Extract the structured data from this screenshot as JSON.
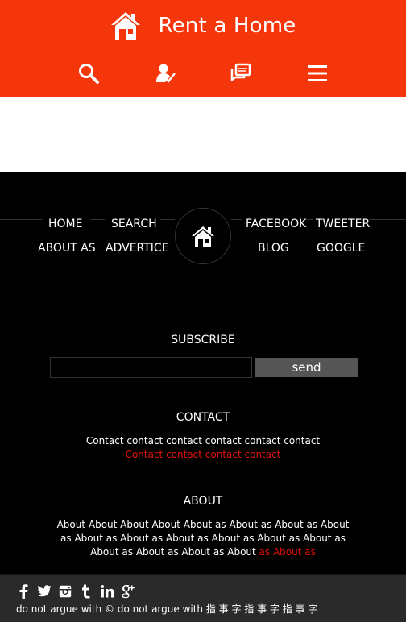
{
  "header": {
    "title": "Rent a Home",
    "nav_icons": [
      "search-icon",
      "user-check-icon",
      "chat-icon",
      "menu-icon"
    ]
  },
  "footer_nav": {
    "links_left": [
      "HOME",
      "SEARCH",
      "ABOUT AS",
      "ADVERTICE"
    ],
    "links_right": [
      "FACEBOOK",
      "TWEETER",
      "BLOG",
      "GOOGLE"
    ],
    "center_icon": "home-icon"
  },
  "subscribe": {
    "title": "SUBSCRIBE",
    "input_value": "",
    "input_placeholder": "",
    "button_label": "send"
  },
  "contact": {
    "title": "CONTACT",
    "line1": "Contact contact contact contact contact contact",
    "line2": "Contact contact contact contact"
  },
  "about": {
    "title": "ABOUT",
    "text": "About About About About About as About as About as About as About as About as About as About as About as About as About as About as About as About",
    "highlight": " as About as"
  },
  "bottom": {
    "socials": [
      "facebook-icon",
      "twitter-icon",
      "instagram-icon",
      "tumblr-icon",
      "linkedin-icon",
      "googleplus-icon"
    ],
    "copyright": "do not argue with © do not argue with 指 事 字 指 事 字 指 事 字"
  },
  "colors": {
    "accent": "#f4360a",
    "link_red": "#e3120b",
    "background": "#000000",
    "bottom_bar": "#2a2a2a"
  }
}
